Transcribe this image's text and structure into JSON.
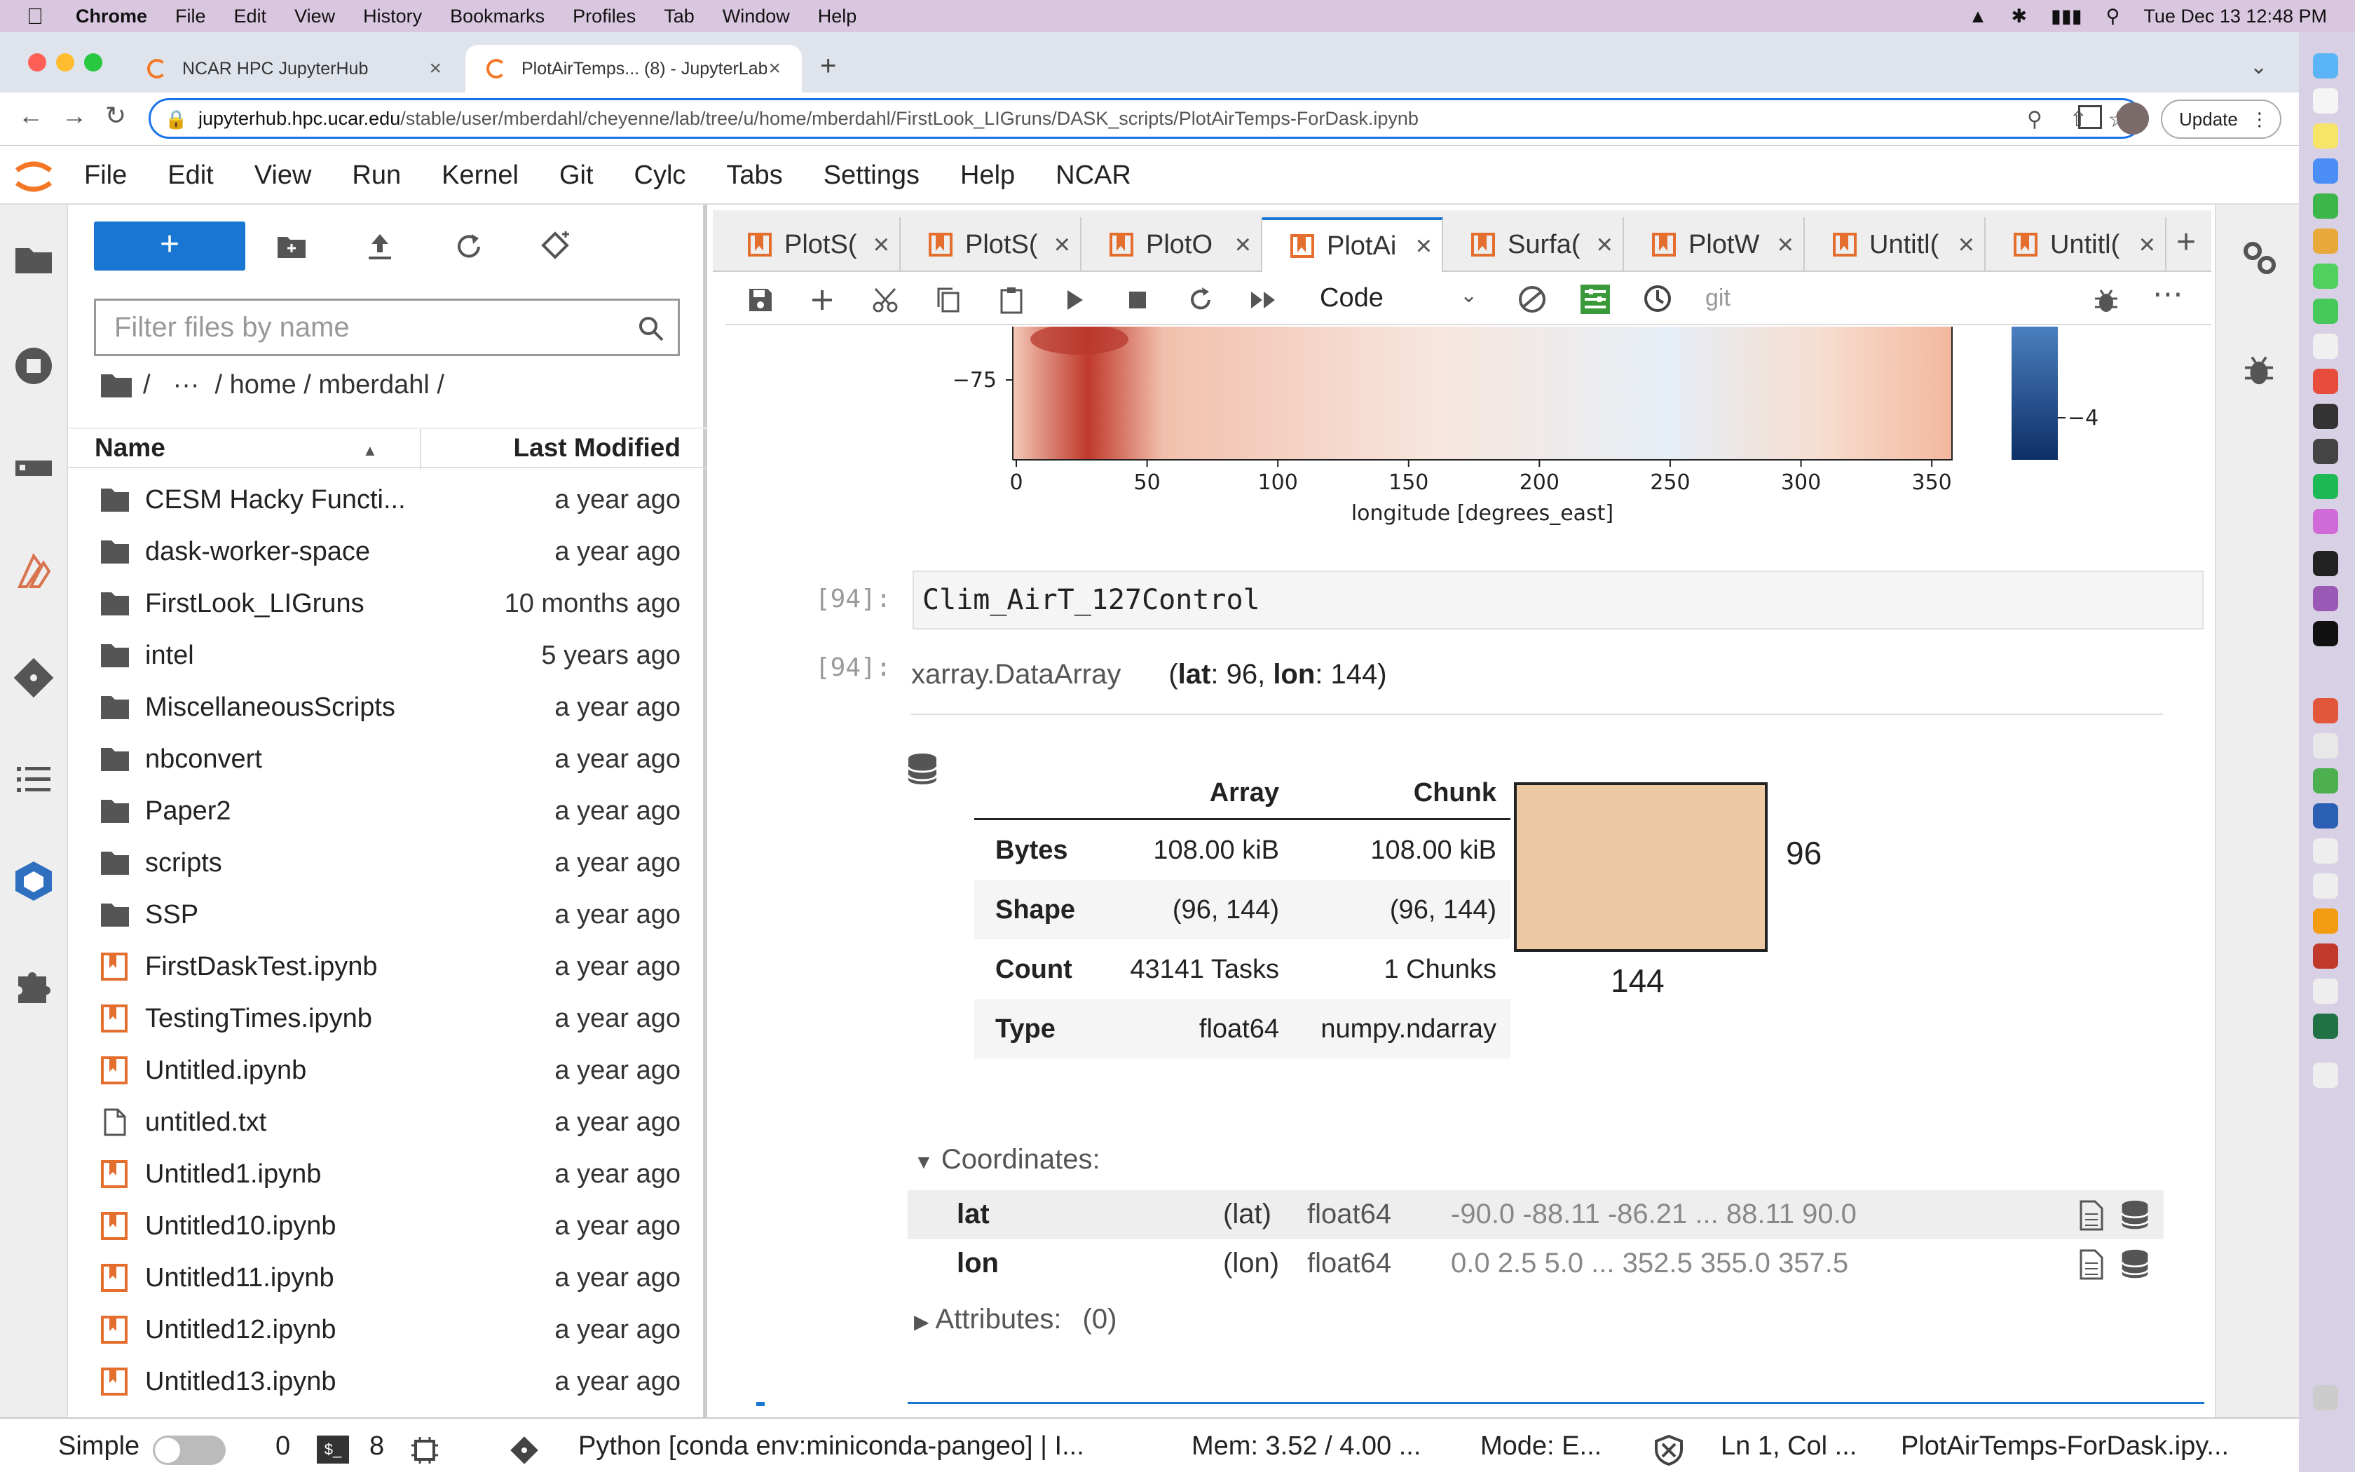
{
  "menubar": {
    "app": "Chrome",
    "items": [
      "File",
      "Edit",
      "View",
      "History",
      "Bookmarks",
      "Profiles",
      "Tab",
      "Window",
      "Help"
    ],
    "clock": "Tue Dec 13  12:48 PM"
  },
  "browser": {
    "tabs": [
      {
        "label": "NCAR HPC JupyterHub"
      },
      {
        "label": "PlotAirTemps... (8) - JupyterLab"
      }
    ],
    "url_host": "jupyterhub.hpc.ucar.edu",
    "url_path": "/stable/user/mberdahl/cheyenne/lab/tree/u/home/mberdahl/FirstLook_LIGruns/DASK_scripts/PlotAirTemps-ForDask.ipynb",
    "update_label": "Update"
  },
  "jupyter": {
    "menu": [
      "File",
      "Edit",
      "View",
      "Run",
      "Kernel",
      "Git",
      "Cylc",
      "Tabs",
      "Settings",
      "Help",
      "NCAR"
    ]
  },
  "filebrowser": {
    "new_label": "+",
    "filter_placeholder": "Filter files by name",
    "breadcrumb": {
      "root": "/",
      "ellipsis": "···",
      "path": "/ home / mberdahl /"
    },
    "col_name": "Name",
    "col_modified": "Last Modified",
    "items": [
      {
        "name": "CESM Hacky Functi...",
        "modified": "a year ago",
        "type": "folder"
      },
      {
        "name": "dask-worker-space",
        "modified": "a year ago",
        "type": "folder"
      },
      {
        "name": "FirstLook_LIGruns",
        "modified": "10 months ago",
        "type": "folder"
      },
      {
        "name": "intel",
        "modified": "5 years ago",
        "type": "folder"
      },
      {
        "name": "MiscellaneousScripts",
        "modified": "a year ago",
        "type": "folder"
      },
      {
        "name": "nbconvert",
        "modified": "a year ago",
        "type": "folder"
      },
      {
        "name": "Paper2",
        "modified": "a year ago",
        "type": "folder"
      },
      {
        "name": "scripts",
        "modified": "a year ago",
        "type": "folder"
      },
      {
        "name": "SSP",
        "modified": "a year ago",
        "type": "folder"
      },
      {
        "name": "FirstDaskTest.ipynb",
        "modified": "a year ago",
        "type": "notebook"
      },
      {
        "name": "TestingTimes.ipynb",
        "modified": "a year ago",
        "type": "notebook"
      },
      {
        "name": "Untitled.ipynb",
        "modified": "a year ago",
        "type": "notebook"
      },
      {
        "name": "untitled.txt",
        "modified": "a year ago",
        "type": "text"
      },
      {
        "name": "Untitled1.ipynb",
        "modified": "a year ago",
        "type": "notebook"
      },
      {
        "name": "Untitled10.ipynb",
        "modified": "a year ago",
        "type": "notebook"
      },
      {
        "name": "Untitled11.ipynb",
        "modified": "a year ago",
        "type": "notebook"
      },
      {
        "name": "Untitled12.ipynb",
        "modified": "a year ago",
        "type": "notebook"
      },
      {
        "name": "Untitled13.ipynb",
        "modified": "a year ago",
        "type": "notebook"
      }
    ]
  },
  "notebook_tabs": [
    {
      "label": "PlotS("
    },
    {
      "label": "PlotS("
    },
    {
      "label": "PlotO"
    },
    {
      "label": "PlotAi"
    },
    {
      "label": "Surfa("
    },
    {
      "label": "PlotW"
    },
    {
      "label": "Untitl("
    },
    {
      "label": "Untitl("
    }
  ],
  "toolbar": {
    "cell_type": "Code",
    "git": "git"
  },
  "plot": {
    "ytick": "−75",
    "xticks": [
      "0",
      "50",
      "100",
      "150",
      "200",
      "250",
      "300",
      "350"
    ],
    "xlabel": "longitude [degrees_east]",
    "colorbar_tick": "−4"
  },
  "cells": {
    "in_prompt": "[94]:",
    "code": "Clim_AirT_127Control",
    "out_prompt": "[94]:"
  },
  "dataarray": {
    "type": "xarray.DataArray",
    "dims_open": "(",
    "dim1_name": "lat",
    "dim1_val": ": 96, ",
    "dim2_name": "lon",
    "dim2_val": ": 144)",
    "table_headers": [
      "Array",
      "Chunk"
    ],
    "rows": [
      {
        "label": "Bytes",
        "array": "108.00 kiB",
        "chunk": "108.00 kiB"
      },
      {
        "label": "Shape",
        "array": "(96, 144)",
        "chunk": "(96, 144)"
      },
      {
        "label": "Count",
        "array": "43141 Tasks",
        "chunk": "1 Chunks"
      },
      {
        "label": "Type",
        "array": "float64",
        "chunk": "numpy.ndarray"
      }
    ],
    "chunk_rows": "96",
    "chunk_cols": "144",
    "coords_title": "Coordinates:",
    "coords": [
      {
        "name": "lat",
        "dims": "(lat)",
        "dtype": "float64",
        "preview": "-90.0 -88.11 -86.21 ... 88.11 90.0"
      },
      {
        "name": "lon",
        "dims": "(lon)",
        "dtype": "float64",
        "preview": "0.0 2.5 5.0 ... 352.5 355.0 357.5"
      }
    ],
    "attrs_title": "Attributes:",
    "attrs_count": "(0)"
  },
  "status": {
    "mode": "Simple",
    "terminals": "0",
    "kernels": "8",
    "kernel": "Python [conda env:miniconda-pangeo] | I...",
    "mem": "Mem: 3.52 / 4.00 ...",
    "edit_mode": "Mode: E...",
    "position": "Ln 1, Col ...",
    "file": "PlotAirTemps-ForDask.ipy..."
  }
}
